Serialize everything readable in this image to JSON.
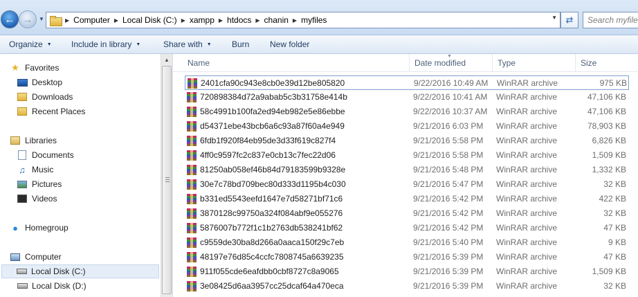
{
  "address": {
    "crumbs": [
      "Computer",
      "Local Disk (C:)",
      "xampp",
      "htdocs",
      "chanin",
      "myfiles"
    ],
    "search_placeholder": "Search myfiles"
  },
  "toolbar": {
    "organize": "Organize",
    "include_in_library": "Include in library",
    "share_with": "Share with",
    "burn": "Burn",
    "new_folder": "New folder"
  },
  "navpane": {
    "favorites": "Favorites",
    "desktop": "Desktop",
    "downloads": "Downloads",
    "recent_places": "Recent Places",
    "libraries": "Libraries",
    "documents": "Documents",
    "music": "Music",
    "pictures": "Pictures",
    "videos": "Videos",
    "homegroup": "Homegroup",
    "computer": "Computer",
    "local_disk_c": "Local Disk (C:)",
    "local_disk_d": "Local Disk (D:)"
  },
  "columns": {
    "name": "Name",
    "date_modified": "Date modified",
    "type": "Type",
    "size": "Size"
  },
  "files": [
    {
      "name": "2401cfa90c943e8cb0e39d12be805820",
      "date": "9/22/2016 10:49 AM",
      "type": "WinRAR archive",
      "size": "975 KB"
    },
    {
      "name": "720898384d72a9abab5c3b31758e414b",
      "date": "9/22/2016 10:41 AM",
      "type": "WinRAR archive",
      "size": "47,106 KB"
    },
    {
      "name": "58c4991b100fa2ed94eb982e5e86ebbe",
      "date": "9/22/2016 10:37 AM",
      "type": "WinRAR archive",
      "size": "47,106 KB"
    },
    {
      "name": "d54371ebe43bcb6a6c93a87f60a4e949",
      "date": "9/21/2016 6:03 PM",
      "type": "WinRAR archive",
      "size": "78,903 KB"
    },
    {
      "name": "6fdb1f920f84eb95de3d33f619c827f4",
      "date": "9/21/2016 5:58 PM",
      "type": "WinRAR archive",
      "size": "6,826 KB"
    },
    {
      "name": "4ff0c9597fc2c837e0cb13c7fec22d06",
      "date": "9/21/2016 5:58 PM",
      "type": "WinRAR archive",
      "size": "1,509 KB"
    },
    {
      "name": "81250ab058ef46b84d79183599b9328e",
      "date": "9/21/2016 5:48 PM",
      "type": "WinRAR archive",
      "size": "1,332 KB"
    },
    {
      "name": "30e7c78bd709bec80d333d1195b4c030",
      "date": "9/21/2016 5:47 PM",
      "type": "WinRAR archive",
      "size": "32 KB"
    },
    {
      "name": "b331ed5543eefd1647e7d58271bf71c6",
      "date": "9/21/2016 5:42 PM",
      "type": "WinRAR archive",
      "size": "422 KB"
    },
    {
      "name": "3870128c99750a324f084abf9e055276",
      "date": "9/21/2016 5:42 PM",
      "type": "WinRAR archive",
      "size": "32 KB"
    },
    {
      "name": "5876007b772f1c1b2763db538241bf62",
      "date": "9/21/2016 5:42 PM",
      "type": "WinRAR archive",
      "size": "47 KB"
    },
    {
      "name": "c9559de30ba8d266a0aaca150f29c7eb",
      "date": "9/21/2016 5:40 PM",
      "type": "WinRAR archive",
      "size": "9 KB"
    },
    {
      "name": "48197e76d85c4ccfc7808745a6639235",
      "date": "9/21/2016 5:39 PM",
      "type": "WinRAR archive",
      "size": "47 KB"
    },
    {
      "name": "911f055cde6eafdbb0cbf8727c8a9065",
      "date": "9/21/2016 5:39 PM",
      "type": "WinRAR archive",
      "size": "1,509 KB"
    },
    {
      "name": "3e08425d6aa3957cc25dcaf64a470eca",
      "date": "9/21/2016 5:39 PM",
      "type": "WinRAR archive",
      "size": "32 KB"
    }
  ]
}
